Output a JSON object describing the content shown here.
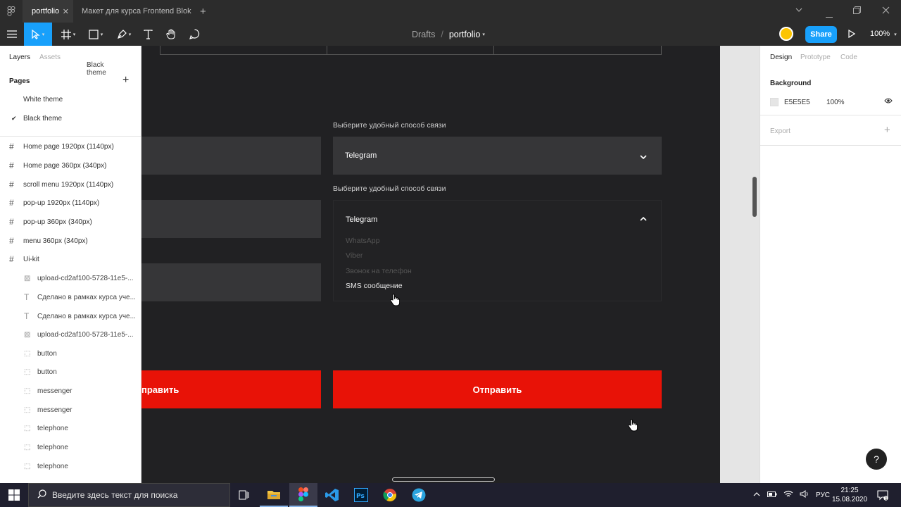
{
  "titlebar": {
    "tabs": [
      {
        "label": "portfolio"
      },
      {
        "label": "Макет для курса Frontend Blok"
      }
    ],
    "close_glyph": "✕",
    "add_glyph": "+"
  },
  "toolbar": {
    "breadcrumb_root": "Drafts",
    "breadcrumb_sep": "/",
    "file_name": "portfolio",
    "share_label": "Share",
    "zoom": "100%"
  },
  "left_panel": {
    "tabs": {
      "layers": "Layers",
      "assets": "Assets",
      "theme": "Black theme"
    },
    "pages_heading": "Pages",
    "pages": [
      {
        "label": "White theme",
        "selected": false
      },
      {
        "label": "Black theme",
        "selected": true
      }
    ],
    "layers": [
      {
        "label": "Home page 1920px (1140px)",
        "type": "frame"
      },
      {
        "label": "Home page 360px (340px)",
        "type": "frame"
      },
      {
        "label": "scroll menu 1920px (1140px)",
        "type": "frame"
      },
      {
        "label": "pop-up 1920px (1140px)",
        "type": "frame"
      },
      {
        "label": "pop-up 360px (340px)",
        "type": "frame"
      },
      {
        "label": "menu 360px (340px)",
        "type": "frame"
      },
      {
        "label": "Ui-kit",
        "type": "frame"
      },
      {
        "label": "upload-cd2af100-5728-11e5-...",
        "type": "image"
      },
      {
        "label": "Сделано в рамках курса уче...",
        "type": "text"
      },
      {
        "label": "Сделано в рамках курса уче...",
        "type": "text"
      },
      {
        "label": "upload-cd2af100-5728-11e5-...",
        "type": "image"
      },
      {
        "label": "button",
        "type": "component"
      },
      {
        "label": "button",
        "type": "component"
      },
      {
        "label": "messenger",
        "type": "component"
      },
      {
        "label": "messenger",
        "type": "component"
      },
      {
        "label": "telephone",
        "type": "component"
      },
      {
        "label": "telephone",
        "type": "component"
      },
      {
        "label": "telephone",
        "type": "component"
      }
    ]
  },
  "canvas": {
    "select_label_1": "Выберите удобный способ связи",
    "select_value_1": "Telegram",
    "select_label_2": "Выберите удобный способ связи",
    "select_value_2": "Telegram",
    "options": [
      {
        "label": "WhatsApp",
        "active": false
      },
      {
        "label": "Viber",
        "active": false
      },
      {
        "label": "Звонок на телефон",
        "active": false
      },
      {
        "label": "SMS сообщение",
        "active": true
      }
    ],
    "button_left_label": "править",
    "button_right_label": "Отправить"
  },
  "right_panel": {
    "tabs": {
      "design": "Design",
      "prototype": "Prototype",
      "code": "Code"
    },
    "background_heading": "Background",
    "background_hex": "E5E5E5",
    "background_opacity": "100%",
    "export_heading": "Export"
  },
  "taskbar": {
    "search_placeholder": "Введите здесь текст для поиска",
    "language": "РУС",
    "time": "21:25",
    "date": "15.08.2020",
    "apps": [
      "task-view",
      "file-explorer",
      "figma",
      "vscode",
      "photoshop",
      "chrome",
      "telegram"
    ]
  },
  "colors": {
    "accent": "#18a0fb",
    "button_red": "#e81207",
    "frame_bg": "#212123",
    "field_bg": "#363638"
  }
}
